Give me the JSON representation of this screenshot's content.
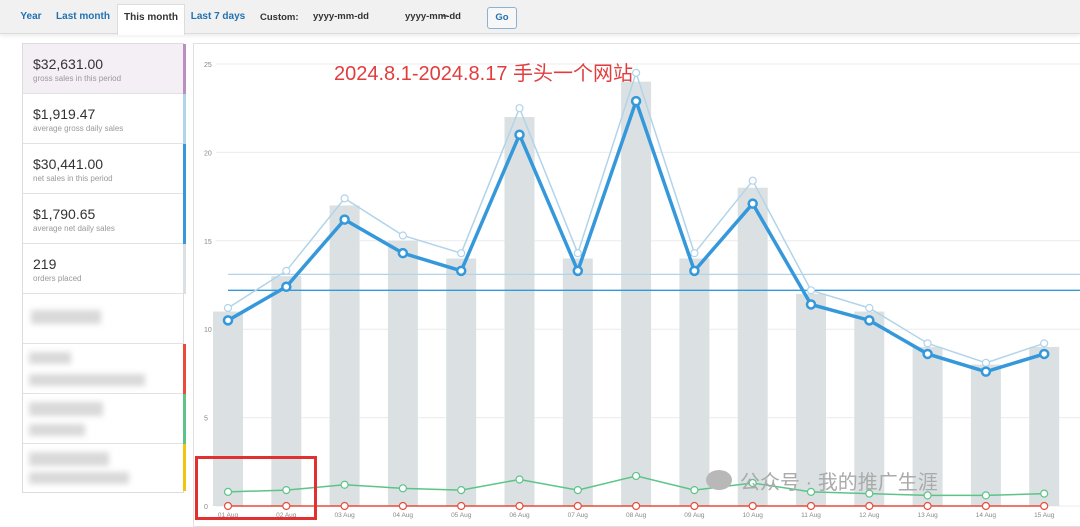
{
  "toolbar": {
    "tabs": [
      {
        "label": "Year",
        "active": false
      },
      {
        "label": "Last month",
        "active": false
      },
      {
        "label": "This month",
        "active": true
      },
      {
        "label": "Last 7 days",
        "active": false
      }
    ],
    "custom_label": "Custom:",
    "date_from_placeholder": "yyyy-mm-dd",
    "date_to_placeholder": "yyyy-mm-dd",
    "date_separator": "–",
    "go_label": "Go"
  },
  "sidebar": {
    "cards": [
      {
        "value": "$32,631.00",
        "label": "gross sales in this period",
        "color": "#b1d4ea"
      },
      {
        "value": "$1,919.47",
        "label": "average gross daily sales",
        "color": "#b1d4ea"
      },
      {
        "value": "$30,441.00",
        "label": "net sales in this period",
        "color": "#3498db"
      },
      {
        "value": "$1,790.65",
        "label": "average net daily sales",
        "color": "#3498db"
      },
      {
        "value": "219",
        "label": "orders placed",
        "color": "#dbe1e3"
      }
    ]
  },
  "annotation": "2024.8.1-2024.8.17  手头一个网站",
  "watermark": "公众号 · 我的推广生涯",
  "chart_data": {
    "type": "bar",
    "title": "",
    "ylim": [
      0,
      25
    ],
    "y_ticks": [
      "0",
      "5",
      "10",
      "15",
      "20",
      "25"
    ],
    "categories": [
      "01 Aug",
      "02 Aug",
      "03 Aug",
      "04 Aug",
      "05 Aug",
      "06 Aug",
      "07 Aug",
      "08 Aug",
      "09 Aug",
      "10 Aug",
      "11 Aug",
      "12 Aug",
      "13 Aug",
      "14 Aug",
      "15 Aug"
    ],
    "series": [
      {
        "kind": "bar",
        "color": "#dbe1e3",
        "values": [
          11,
          13,
          17,
          15,
          14,
          22,
          14,
          24,
          14,
          18,
          12,
          11,
          9,
          8,
          9
        ]
      },
      {
        "kind": "line",
        "color": "#b1d4ea",
        "values": [
          11.2,
          13.3,
          17.4,
          15.3,
          14.3,
          22.5,
          14.3,
          24.5,
          14.3,
          18.4,
          12.2,
          11.2,
          9.2,
          8.1,
          9.2
        ]
      },
      {
        "kind": "line",
        "color": "#3498db",
        "values": [
          10.5,
          12.4,
          16.2,
          14.3,
          13.3,
          21.0,
          13.3,
          22.9,
          13.3,
          17.1,
          11.4,
          10.5,
          8.6,
          7.6,
          8.6
        ]
      },
      {
        "kind": "line",
        "color": "#5cc488",
        "values": [
          0.8,
          0.9,
          1.2,
          1.0,
          0.9,
          1.5,
          0.9,
          1.7,
          0.9,
          1.3,
          0.8,
          0.7,
          0.6,
          0.6,
          0.7
        ]
      },
      {
        "kind": "line",
        "color": "#e74c3c",
        "values": [
          0,
          0,
          0,
          0,
          0,
          0,
          0,
          0,
          0,
          0,
          0,
          0,
          0,
          0,
          0
        ]
      }
    ],
    "avg_lines": [
      {
        "color": "#b1d4ea",
        "value": 13.1
      },
      {
        "color": "#3498db",
        "value": 12.2
      }
    ],
    "grid": true
  }
}
